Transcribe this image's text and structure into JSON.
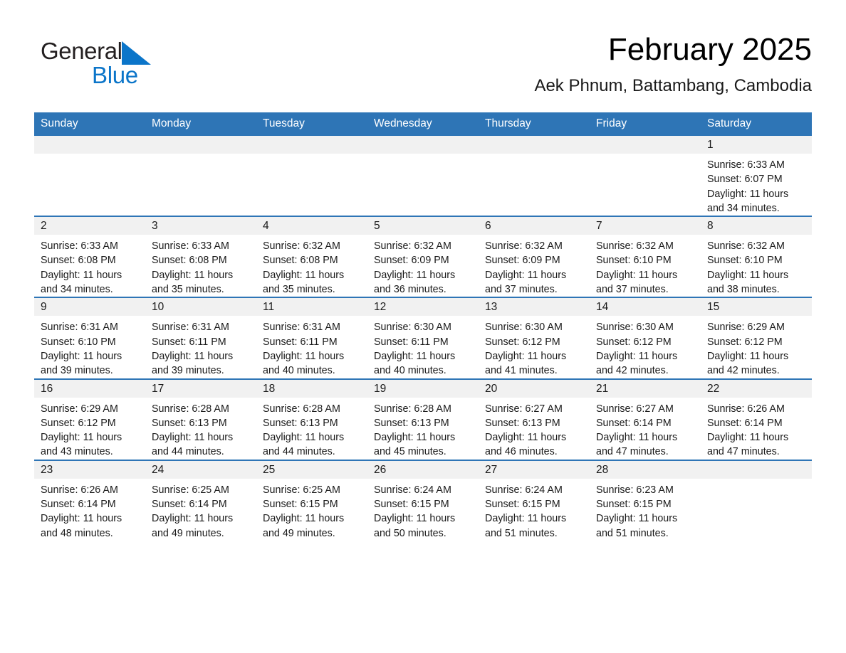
{
  "logo": {
    "word1": "General",
    "word2": "Blue",
    "triangle_icon": "triangle-icon",
    "blue": "#0b75c9"
  },
  "header": {
    "month_title": "February 2025",
    "location": "Aek Phnum, Battambang, Cambodia"
  },
  "theme": {
    "header_blue": "#2e75b6",
    "daynum_band": "#f1f1f1",
    "text": "#1a1a1a"
  },
  "weekday_headers": [
    "Sunday",
    "Monday",
    "Tuesday",
    "Wednesday",
    "Thursday",
    "Friday",
    "Saturday"
  ],
  "weeks": [
    [
      {
        "blank": true
      },
      {
        "blank": true
      },
      {
        "blank": true
      },
      {
        "blank": true
      },
      {
        "blank": true
      },
      {
        "blank": true
      },
      {
        "day": "1",
        "sunrise": "Sunrise: 6:33 AM",
        "sunset": "Sunset: 6:07 PM",
        "daylight": "Daylight: 11 hours and 34 minutes."
      }
    ],
    [
      {
        "day": "2",
        "sunrise": "Sunrise: 6:33 AM",
        "sunset": "Sunset: 6:08 PM",
        "daylight": "Daylight: 11 hours and 34 minutes."
      },
      {
        "day": "3",
        "sunrise": "Sunrise: 6:33 AM",
        "sunset": "Sunset: 6:08 PM",
        "daylight": "Daylight: 11 hours and 35 minutes."
      },
      {
        "day": "4",
        "sunrise": "Sunrise: 6:32 AM",
        "sunset": "Sunset: 6:08 PM",
        "daylight": "Daylight: 11 hours and 35 minutes."
      },
      {
        "day": "5",
        "sunrise": "Sunrise: 6:32 AM",
        "sunset": "Sunset: 6:09 PM",
        "daylight": "Daylight: 11 hours and 36 minutes."
      },
      {
        "day": "6",
        "sunrise": "Sunrise: 6:32 AM",
        "sunset": "Sunset: 6:09 PM",
        "daylight": "Daylight: 11 hours and 37 minutes."
      },
      {
        "day": "7",
        "sunrise": "Sunrise: 6:32 AM",
        "sunset": "Sunset: 6:10 PM",
        "daylight": "Daylight: 11 hours and 37 minutes."
      },
      {
        "day": "8",
        "sunrise": "Sunrise: 6:32 AM",
        "sunset": "Sunset: 6:10 PM",
        "daylight": "Daylight: 11 hours and 38 minutes."
      }
    ],
    [
      {
        "day": "9",
        "sunrise": "Sunrise: 6:31 AM",
        "sunset": "Sunset: 6:10 PM",
        "daylight": "Daylight: 11 hours and 39 minutes."
      },
      {
        "day": "10",
        "sunrise": "Sunrise: 6:31 AM",
        "sunset": "Sunset: 6:11 PM",
        "daylight": "Daylight: 11 hours and 39 minutes."
      },
      {
        "day": "11",
        "sunrise": "Sunrise: 6:31 AM",
        "sunset": "Sunset: 6:11 PM",
        "daylight": "Daylight: 11 hours and 40 minutes."
      },
      {
        "day": "12",
        "sunrise": "Sunrise: 6:30 AM",
        "sunset": "Sunset: 6:11 PM",
        "daylight": "Daylight: 11 hours and 40 minutes."
      },
      {
        "day": "13",
        "sunrise": "Sunrise: 6:30 AM",
        "sunset": "Sunset: 6:12 PM",
        "daylight": "Daylight: 11 hours and 41 minutes."
      },
      {
        "day": "14",
        "sunrise": "Sunrise: 6:30 AM",
        "sunset": "Sunset: 6:12 PM",
        "daylight": "Daylight: 11 hours and 42 minutes."
      },
      {
        "day": "15",
        "sunrise": "Sunrise: 6:29 AM",
        "sunset": "Sunset: 6:12 PM",
        "daylight": "Daylight: 11 hours and 42 minutes."
      }
    ],
    [
      {
        "day": "16",
        "sunrise": "Sunrise: 6:29 AM",
        "sunset": "Sunset: 6:12 PM",
        "daylight": "Daylight: 11 hours and 43 minutes."
      },
      {
        "day": "17",
        "sunrise": "Sunrise: 6:28 AM",
        "sunset": "Sunset: 6:13 PM",
        "daylight": "Daylight: 11 hours and 44 minutes."
      },
      {
        "day": "18",
        "sunrise": "Sunrise: 6:28 AM",
        "sunset": "Sunset: 6:13 PM",
        "daylight": "Daylight: 11 hours and 44 minutes."
      },
      {
        "day": "19",
        "sunrise": "Sunrise: 6:28 AM",
        "sunset": "Sunset: 6:13 PM",
        "daylight": "Daylight: 11 hours and 45 minutes."
      },
      {
        "day": "20",
        "sunrise": "Sunrise: 6:27 AM",
        "sunset": "Sunset: 6:13 PM",
        "daylight": "Daylight: 11 hours and 46 minutes."
      },
      {
        "day": "21",
        "sunrise": "Sunrise: 6:27 AM",
        "sunset": "Sunset: 6:14 PM",
        "daylight": "Daylight: 11 hours and 47 minutes."
      },
      {
        "day": "22",
        "sunrise": "Sunrise: 6:26 AM",
        "sunset": "Sunset: 6:14 PM",
        "daylight": "Daylight: 11 hours and 47 minutes."
      }
    ],
    [
      {
        "day": "23",
        "sunrise": "Sunrise: 6:26 AM",
        "sunset": "Sunset: 6:14 PM",
        "daylight": "Daylight: 11 hours and 48 minutes."
      },
      {
        "day": "24",
        "sunrise": "Sunrise: 6:25 AM",
        "sunset": "Sunset: 6:14 PM",
        "daylight": "Daylight: 11 hours and 49 minutes."
      },
      {
        "day": "25",
        "sunrise": "Sunrise: 6:25 AM",
        "sunset": "Sunset: 6:15 PM",
        "daylight": "Daylight: 11 hours and 49 minutes."
      },
      {
        "day": "26",
        "sunrise": "Sunrise: 6:24 AM",
        "sunset": "Sunset: 6:15 PM",
        "daylight": "Daylight: 11 hours and 50 minutes."
      },
      {
        "day": "27",
        "sunrise": "Sunrise: 6:24 AM",
        "sunset": "Sunset: 6:15 PM",
        "daylight": "Daylight: 11 hours and 51 minutes."
      },
      {
        "day": "28",
        "sunrise": "Sunrise: 6:23 AM",
        "sunset": "Sunset: 6:15 PM",
        "daylight": "Daylight: 11 hours and 51 minutes."
      },
      {
        "blank": true
      }
    ]
  ]
}
